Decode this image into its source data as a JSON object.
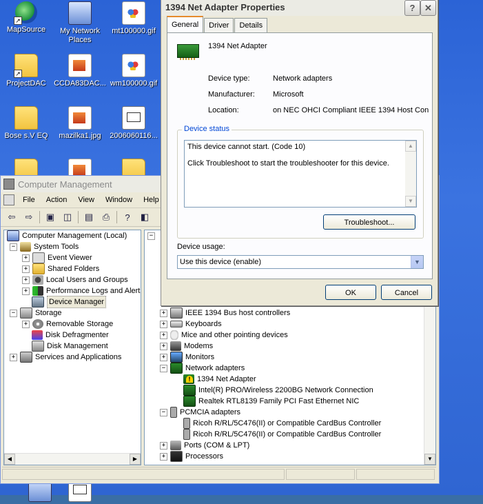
{
  "desktop": {
    "icons": [
      {
        "label": "MapSource"
      },
      {
        "label": "My Network Places"
      },
      {
        "label": "mt100000.gif"
      },
      {
        "label": "ProjectDAC"
      },
      {
        "label": "CCDA83DAC..."
      },
      {
        "label": "wm100000.gif"
      },
      {
        "label": "Bose s.V EQ"
      },
      {
        "label": "mazilka1.jpg"
      },
      {
        "label": "2006060116..."
      }
    ]
  },
  "computer_management": {
    "title": "Computer Management",
    "menu": [
      "File",
      "Action",
      "View",
      "Window",
      "Help"
    ],
    "left_tree": [
      {
        "label": "Computer Management (Local)"
      },
      {
        "label": "System Tools"
      },
      {
        "label": "Event Viewer"
      },
      {
        "label": "Shared Folders"
      },
      {
        "label": "Local Users and Groups"
      },
      {
        "label": "Performance Logs and Alerts"
      },
      {
        "label": "Device Manager"
      },
      {
        "label": "Storage"
      },
      {
        "label": "Removable Storage"
      },
      {
        "label": "Disk Defragmenter"
      },
      {
        "label": "Disk Management"
      },
      {
        "label": "Services and Applications"
      }
    ],
    "right_tree": [
      {
        "label": "IEEE 1394 Bus host controllers"
      },
      {
        "label": "Keyboards"
      },
      {
        "label": "Mice and other pointing devices"
      },
      {
        "label": "Modems"
      },
      {
        "label": "Monitors"
      },
      {
        "label": "Network adapters"
      },
      {
        "label": "1394 Net Adapter"
      },
      {
        "label": "Intel(R) PRO/Wireless 2200BG Network Connection"
      },
      {
        "label": "Realtek RTL8139 Family PCI Fast Ethernet NIC"
      },
      {
        "label": "PCMCIA adapters"
      },
      {
        "label": "Ricoh R/RL/5C476(II) or Compatible CardBus Controller"
      },
      {
        "label": "Ricoh R/RL/5C476(II) or Compatible CardBus Controller"
      },
      {
        "label": "Ports (COM & LPT)"
      },
      {
        "label": "Processors"
      }
    ]
  },
  "dialog": {
    "title": "1394 Net Adapter Properties",
    "help_btn": "?",
    "close_btn": "✕",
    "tabs": [
      "General",
      "Driver",
      "Details"
    ],
    "device_name": "1394 Net Adapter",
    "fields": [
      {
        "label": "Device type:",
        "value": "Network adapters"
      },
      {
        "label": "Manufacturer:",
        "value": "Microsoft"
      },
      {
        "label": "Location:",
        "value": "on NEC OHCI Compliant IEEE 1394 Host Con"
      }
    ],
    "status_group": "Device status",
    "status_line1": "This device cannot start. (Code 10)",
    "status_line2": "Click Troubleshoot to start the troubleshooter for this device.",
    "troubleshoot_btn": "Troubleshoot...",
    "usage_label": "Device usage:",
    "usage_value": "Use this device (enable)",
    "ok_btn": "OK",
    "cancel_btn": "Cancel"
  }
}
